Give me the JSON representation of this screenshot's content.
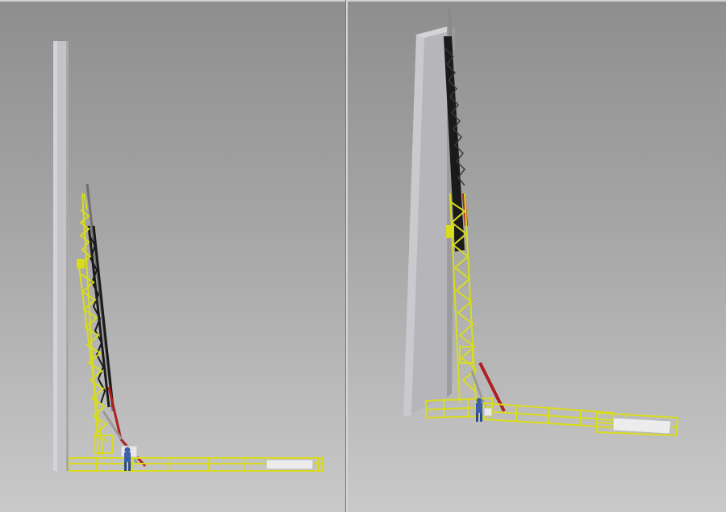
{
  "scene": {
    "view_count": 2,
    "colors": {
      "background_top": "#8e8e8e",
      "background_bottom": "#c9c9c9",
      "frame_yellow": "#d8dc1c",
      "frame_yellow_dark": "#9ea412",
      "lattice_black": "#1a1a1a",
      "cylinder_red": "#b02020",
      "tower_grey": "#c4c4c8",
      "worker_blue": "#3a5fa8",
      "cradle_white": "#e8e8e8"
    },
    "views": [
      {
        "name": "side-view",
        "icon": "tower-erection-rig-side-icon"
      },
      {
        "name": "perspective-view",
        "icon": "tower-erection-rig-perspective-icon"
      }
    ]
  }
}
